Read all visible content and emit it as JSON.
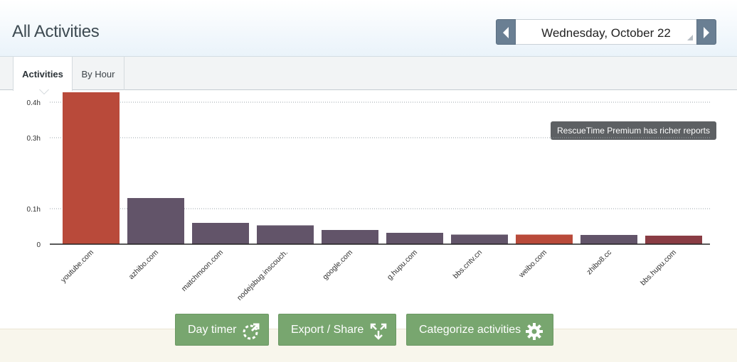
{
  "header": {
    "title": "All Activities"
  },
  "date_nav": {
    "date": "Wednesday, October 22"
  },
  "tabs": [
    {
      "label": "Activities"
    },
    {
      "label": "By Hour"
    }
  ],
  "premium_badge": "RescueTime Premium has richer reports",
  "chart_data": {
    "type": "bar",
    "categories": [
      "youtube.com",
      "azhibo.com",
      "matchmoon.com",
      "nodejsbug.inscouch.",
      "google.com",
      "g.hupu.com",
      "bbs.cntv.cn",
      "weibo.com",
      "zhibo8.cc",
      "bbs.hupu.com"
    ],
    "values": [
      0.46,
      0.13,
      0.06,
      0.053,
      0.04,
      0.032,
      0.027,
      0.027,
      0.026,
      0.024
    ],
    "bar_colors": [
      "#b94a3a",
      "#625469",
      "#625469",
      "#625469",
      "#625469",
      "#625469",
      "#625469",
      "#b94a3a",
      "#625469",
      "#8a3c44"
    ],
    "ylim": [
      0,
      0.5
    ],
    "yticks": [
      {
        "value": 0,
        "label": "0"
      },
      {
        "value": 0.1,
        "label": "0.1h"
      },
      {
        "value": 0.3,
        "label": "0.3h"
      },
      {
        "value": 0.4,
        "label": "0.4h"
      }
    ],
    "grid": true
  },
  "actions": {
    "day_timer": "Day timer",
    "export_share": "Export / Share",
    "categorize": "Categorize activities"
  },
  "colors": {
    "button_green": "#78a66f",
    "nav_blue": "#6a7f93",
    "productive_red": "#b94a3a",
    "neutral_purple": "#625469"
  },
  "icons": {
    "prev": "chevron-left-icon",
    "next": "chevron-right-icon",
    "day_timer": "refresh-clock-icon",
    "export": "expand-arrows-icon",
    "categorize": "gear-icon"
  }
}
